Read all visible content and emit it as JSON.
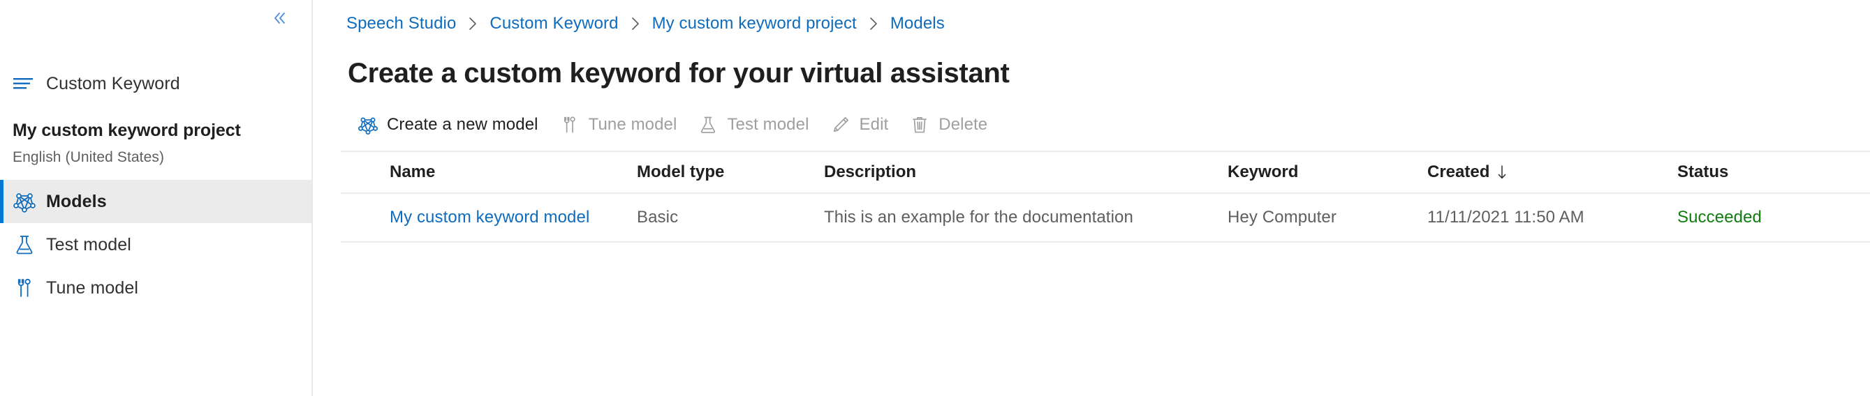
{
  "sidebar": {
    "collapse_icon": "chevron-double-left-icon",
    "nav_top": {
      "icon": "hamburger-lines-icon",
      "label": "Custom Keyword"
    },
    "project": {
      "name": "My custom keyword project",
      "language": "English (United States)"
    },
    "items": [
      {
        "label": "Models",
        "icon": "graph-network-icon",
        "selected": true
      },
      {
        "label": "Test model",
        "icon": "flask-icon",
        "selected": false
      },
      {
        "label": "Tune model",
        "icon": "tuning-tools-icon",
        "selected": false
      }
    ],
    "accent_color": "#0078d4",
    "selected_bg": "#ebebeb"
  },
  "breadcrumb": {
    "separator": "chevron-right-icon",
    "items": [
      "Speech Studio",
      "Custom Keyword",
      "My custom keyword project",
      "Models"
    ],
    "link_color": "#0f6cbd"
  },
  "page": {
    "title": "Create a custom keyword for your virtual assistant"
  },
  "toolbar": {
    "buttons": [
      {
        "label": "Create a new model",
        "icon": "graph-network-icon",
        "disabled": false
      },
      {
        "label": "Tune model",
        "icon": "tuning-tools-icon",
        "disabled": true
      },
      {
        "label": "Test model",
        "icon": "flask-icon",
        "disabled": true
      },
      {
        "label": "Edit",
        "icon": "pencil-icon",
        "disabled": true
      },
      {
        "label": "Delete",
        "icon": "trash-icon",
        "disabled": true
      }
    ]
  },
  "table": {
    "columns": [
      {
        "key": "name",
        "label": "Name",
        "sorted": false
      },
      {
        "key": "type",
        "label": "Model type",
        "sorted": false
      },
      {
        "key": "desc",
        "label": "Description",
        "sorted": false
      },
      {
        "key": "keyword",
        "label": "Keyword",
        "sorted": false
      },
      {
        "key": "created",
        "label": "Created",
        "sorted": true,
        "sort_icon": "arrow-down-icon"
      },
      {
        "key": "status",
        "label": "Status",
        "sorted": false
      }
    ],
    "rows": [
      {
        "name": "My custom keyword model",
        "type": "Basic",
        "desc": "This is an example for the documentation",
        "keyword": "Hey Computer",
        "created": "11/11/2021 11:50 AM",
        "status": "Succeeded",
        "status_color": "#107c10"
      }
    ]
  }
}
